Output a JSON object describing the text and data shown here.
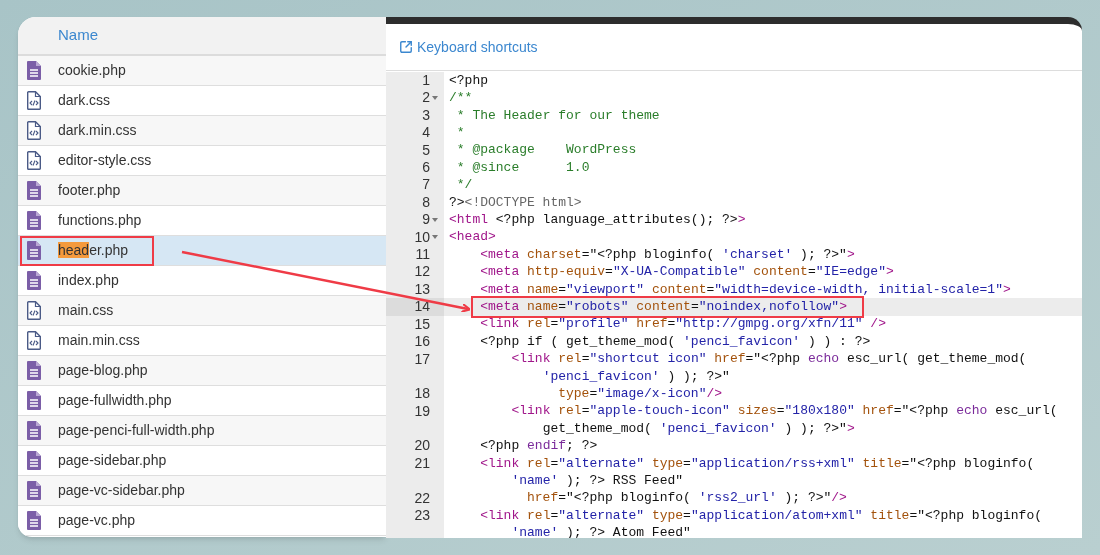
{
  "file_list": {
    "column_header": "Name",
    "files": [
      {
        "kind": "php",
        "selected": false,
        "parts": [
          {
            "text": "cookie.php",
            "highlighted": false
          }
        ]
      },
      {
        "kind": "css",
        "selected": false,
        "parts": [
          {
            "text": "dark.css",
            "highlighted": false
          }
        ]
      },
      {
        "kind": "css",
        "selected": false,
        "parts": [
          {
            "text": "dark.min.css",
            "highlighted": false
          }
        ]
      },
      {
        "kind": "css",
        "selected": false,
        "parts": [
          {
            "text": "editor-style.css",
            "highlighted": false
          }
        ]
      },
      {
        "kind": "php",
        "selected": false,
        "parts": [
          {
            "text": "footer.php",
            "highlighted": false
          }
        ]
      },
      {
        "kind": "php",
        "selected": false,
        "parts": [
          {
            "text": "functions.php",
            "highlighted": false
          }
        ]
      },
      {
        "kind": "php",
        "selected": true,
        "annotated": true,
        "parts": [
          {
            "text": "head",
            "highlighted": true
          },
          {
            "text": "er.php",
            "highlighted": false
          }
        ]
      },
      {
        "kind": "php",
        "selected": false,
        "parts": [
          {
            "text": "index.php",
            "highlighted": false
          }
        ]
      },
      {
        "kind": "css",
        "selected": false,
        "parts": [
          {
            "text": "main.css",
            "highlighted": false
          }
        ]
      },
      {
        "kind": "css",
        "selected": false,
        "parts": [
          {
            "text": "main.min.css",
            "highlighted": false
          }
        ]
      },
      {
        "kind": "php",
        "selected": false,
        "parts": [
          {
            "text": "page-blog.php",
            "highlighted": false
          }
        ]
      },
      {
        "kind": "php",
        "selected": false,
        "parts": [
          {
            "text": "page-fullwidth.php",
            "highlighted": false
          }
        ]
      },
      {
        "kind": "php",
        "selected": false,
        "parts": [
          {
            "text": "page-penci-full-width.php",
            "highlighted": false
          }
        ]
      },
      {
        "kind": "php",
        "selected": false,
        "parts": [
          {
            "text": "page-sidebar.php",
            "highlighted": false
          }
        ]
      },
      {
        "kind": "php",
        "selected": false,
        "parts": [
          {
            "text": "page-vc-sidebar.php",
            "highlighted": false
          }
        ]
      },
      {
        "kind": "php",
        "selected": false,
        "parts": [
          {
            "text": "page-vc.php",
            "highlighted": false
          }
        ]
      }
    ]
  },
  "editor": {
    "shortcuts_link": "Keyboard shortcuts",
    "lines": [
      {
        "number": "1",
        "foldable": false,
        "highlighted": false,
        "rows": [
          {
            "tokens": [
              {
                "kind": "plain",
                "text": "<?php"
              }
            ]
          }
        ]
      },
      {
        "number": "2",
        "foldable": true,
        "highlighted": false,
        "rows": [
          {
            "tokens": [
              {
                "kind": "comment",
                "text": "/**"
              }
            ]
          }
        ]
      },
      {
        "number": "3",
        "foldable": false,
        "highlighted": false,
        "rows": [
          {
            "tokens": [
              {
                "kind": "comment",
                "text": " * The Header for our theme"
              }
            ]
          }
        ]
      },
      {
        "number": "4",
        "foldable": false,
        "highlighted": false,
        "rows": [
          {
            "tokens": [
              {
                "kind": "comment",
                "text": " *"
              }
            ]
          }
        ]
      },
      {
        "number": "5",
        "foldable": false,
        "highlighted": false,
        "rows": [
          {
            "tokens": [
              {
                "kind": "comment",
                "text": " * @package    WordPress"
              }
            ]
          }
        ]
      },
      {
        "number": "6",
        "foldable": false,
        "highlighted": false,
        "rows": [
          {
            "tokens": [
              {
                "kind": "comment",
                "text": " * @since      1.0"
              }
            ]
          }
        ]
      },
      {
        "number": "7",
        "foldable": false,
        "highlighted": false,
        "rows": [
          {
            "tokens": [
              {
                "kind": "comment",
                "text": " */"
              }
            ]
          }
        ]
      },
      {
        "number": "8",
        "foldable": false,
        "highlighted": false,
        "rows": [
          {
            "tokens": [
              {
                "kind": "plain",
                "text": "?>"
              },
              {
                "kind": "doctype",
                "text": "<!DOCTYPE html>"
              }
            ]
          }
        ]
      },
      {
        "number": "9",
        "foldable": true,
        "highlighted": false,
        "rows": [
          {
            "tokens": [
              {
                "kind": "tag",
                "text": "<html"
              },
              {
                "kind": "plain",
                "text": " <?php language_attributes(); ?>"
              },
              {
                "kind": "tag",
                "text": ">"
              }
            ]
          }
        ]
      },
      {
        "number": "10",
        "foldable": true,
        "highlighted": false,
        "rows": [
          {
            "tokens": [
              {
                "kind": "tag",
                "text": "<head>"
              }
            ]
          }
        ]
      },
      {
        "number": "11",
        "foldable": false,
        "highlighted": false,
        "rows": [
          {
            "tokens": [
              {
                "kind": "tag",
                "text": "    <meta"
              },
              {
                "kind": "attr",
                "text": " charset"
              },
              {
                "kind": "plain",
                "text": "=\"<?php bloginfo( "
              },
              {
                "kind": "string",
                "text": "'charset'"
              },
              {
                "kind": "plain",
                "text": " ); ?>\""
              },
              {
                "kind": "tag",
                "text": ">"
              }
            ]
          }
        ]
      },
      {
        "number": "12",
        "foldable": false,
        "highlighted": false,
        "rows": [
          {
            "tokens": [
              {
                "kind": "tag",
                "text": "    <meta"
              },
              {
                "kind": "attr",
                "text": " http-equiv"
              },
              {
                "kind": "plain",
                "text": "="
              },
              {
                "kind": "string",
                "text": "\"X-UA-Compatible\""
              },
              {
                "kind": "attr",
                "text": " content"
              },
              {
                "kind": "plain",
                "text": "="
              },
              {
                "kind": "string",
                "text": "\"IE=edge\""
              },
              {
                "kind": "tag",
                "text": ">"
              }
            ]
          }
        ]
      },
      {
        "number": "13",
        "foldable": false,
        "highlighted": false,
        "rows": [
          {
            "tokens": [
              {
                "kind": "tag",
                "text": "    <meta"
              },
              {
                "kind": "attr",
                "text": " name"
              },
              {
                "kind": "plain",
                "text": "="
              },
              {
                "kind": "string",
                "text": "\"viewport\""
              },
              {
                "kind": "attr",
                "text": " content"
              },
              {
                "kind": "plain",
                "text": "="
              },
              {
                "kind": "string",
                "text": "\"width=device-width, initial-scale=1\""
              },
              {
                "kind": "tag",
                "text": ">"
              }
            ]
          }
        ]
      },
      {
        "number": "14",
        "foldable": false,
        "highlighted": true,
        "annotated": true,
        "rows": [
          {
            "tokens": [
              {
                "kind": "tag",
                "text": "    <meta"
              },
              {
                "kind": "attr",
                "text": " name"
              },
              {
                "kind": "plain",
                "text": "="
              },
              {
                "kind": "string",
                "text": "\"robots\""
              },
              {
                "kind": "attr",
                "text": " content"
              },
              {
                "kind": "plain",
                "text": "="
              },
              {
                "kind": "string",
                "text": "\"noindex,nofollow\""
              },
              {
                "kind": "tag",
                "text": ">"
              }
            ]
          }
        ]
      },
      {
        "number": "15",
        "foldable": false,
        "highlighted": false,
        "rows": [
          {
            "tokens": [
              {
                "kind": "tag",
                "text": "    <link"
              },
              {
                "kind": "attr",
                "text": " rel"
              },
              {
                "kind": "plain",
                "text": "="
              },
              {
                "kind": "string",
                "text": "\"profile\""
              },
              {
                "kind": "attr",
                "text": " href"
              },
              {
                "kind": "plain",
                "text": "="
              },
              {
                "kind": "string",
                "text": "\"http://gmpg.org/xfn/11\""
              },
              {
                "kind": "tag",
                "text": " />"
              }
            ]
          }
        ]
      },
      {
        "number": "16",
        "foldable": false,
        "highlighted": false,
        "rows": [
          {
            "tokens": [
              {
                "kind": "plain",
                "text": "    <?php if ( get_theme_mod( "
              },
              {
                "kind": "string",
                "text": "'penci_favicon'"
              },
              {
                "kind": "plain",
                "text": " ) ) : ?>"
              }
            ]
          }
        ]
      },
      {
        "number": "17",
        "foldable": false,
        "highlighted": false,
        "rows": [
          {
            "tokens": [
              {
                "kind": "tag",
                "text": "        <link"
              },
              {
                "kind": "attr",
                "text": " rel"
              },
              {
                "kind": "plain",
                "text": "="
              },
              {
                "kind": "string",
                "text": "\"shortcut icon\""
              },
              {
                "kind": "attr",
                "text": " href"
              },
              {
                "kind": "plain",
                "text": "=\"<?php "
              },
              {
                "kind": "keyword",
                "text": "echo"
              },
              {
                "kind": "plain",
                "text": " esc_url( get_theme_mod("
              }
            ]
          },
          {
            "tokens": [
              {
                "kind": "string",
                "text": "            'penci_favicon'"
              },
              {
                "kind": "plain",
                "text": " ) ); ?>\""
              }
            ]
          }
        ]
      },
      {
        "number": "18",
        "foldable": false,
        "highlighted": false,
        "rows": [
          {
            "tokens": [
              {
                "kind": "attr",
                "text": "              type"
              },
              {
                "kind": "plain",
                "text": "="
              },
              {
                "kind": "string",
                "text": "\"image/x-icon\""
              },
              {
                "kind": "tag",
                "text": "/>"
              }
            ]
          }
        ]
      },
      {
        "number": "19",
        "foldable": false,
        "highlighted": false,
        "rows": [
          {
            "tokens": [
              {
                "kind": "tag",
                "text": "        <link"
              },
              {
                "kind": "attr",
                "text": " rel"
              },
              {
                "kind": "plain",
                "text": "="
              },
              {
                "kind": "string",
                "text": "\"apple-touch-icon\""
              },
              {
                "kind": "attr",
                "text": " sizes"
              },
              {
                "kind": "plain",
                "text": "="
              },
              {
                "kind": "string",
                "text": "\"180x180\""
              },
              {
                "kind": "attr",
                "text": " href"
              },
              {
                "kind": "plain",
                "text": "=\"<?php "
              },
              {
                "kind": "keyword",
                "text": "echo"
              },
              {
                "kind": "plain",
                "text": " esc_url("
              }
            ]
          },
          {
            "tokens": [
              {
                "kind": "plain",
                "text": "            get_theme_mod( "
              },
              {
                "kind": "string",
                "text": "'penci_favicon'"
              },
              {
                "kind": "plain",
                "text": " ) ); ?>\""
              },
              {
                "kind": "tag",
                "text": ">"
              }
            ]
          }
        ]
      },
      {
        "number": "20",
        "foldable": false,
        "highlighted": false,
        "rows": [
          {
            "tokens": [
              {
                "kind": "plain",
                "text": "    <?php "
              },
              {
                "kind": "keyword",
                "text": "endif"
              },
              {
                "kind": "plain",
                "text": "; ?>"
              }
            ]
          }
        ]
      },
      {
        "number": "21",
        "foldable": false,
        "highlighted": false,
        "rows": [
          {
            "tokens": [
              {
                "kind": "tag",
                "text": "    <link"
              },
              {
                "kind": "attr",
                "text": " rel"
              },
              {
                "kind": "plain",
                "text": "="
              },
              {
                "kind": "string",
                "text": "\"alternate\""
              },
              {
                "kind": "attr",
                "text": " type"
              },
              {
                "kind": "plain",
                "text": "="
              },
              {
                "kind": "string",
                "text": "\"application/rss+xml\""
              },
              {
                "kind": "attr",
                "text": " title"
              },
              {
                "kind": "plain",
                "text": "=\"<?php bloginfo("
              }
            ]
          },
          {
            "tokens": [
              {
                "kind": "string",
                "text": "        'name'"
              },
              {
                "kind": "plain",
                "text": " ); ?> RSS Feed\""
              }
            ]
          }
        ]
      },
      {
        "number": "22",
        "foldable": false,
        "highlighted": false,
        "rows": [
          {
            "tokens": [
              {
                "kind": "attr",
                "text": "          href"
              },
              {
                "kind": "plain",
                "text": "=\"<?php bloginfo( "
              },
              {
                "kind": "string",
                "text": "'rss2_url'"
              },
              {
                "kind": "plain",
                "text": " ); ?>\""
              },
              {
                "kind": "tag",
                "text": "/>"
              }
            ]
          }
        ]
      },
      {
        "number": "23",
        "foldable": false,
        "highlighted": false,
        "rows": [
          {
            "tokens": [
              {
                "kind": "tag",
                "text": "    <link"
              },
              {
                "kind": "attr",
                "text": " rel"
              },
              {
                "kind": "plain",
                "text": "="
              },
              {
                "kind": "string",
                "text": "\"alternate\""
              },
              {
                "kind": "attr",
                "text": " type"
              },
              {
                "kind": "plain",
                "text": "="
              },
              {
                "kind": "string",
                "text": "\"application/atom+xml\""
              },
              {
                "kind": "attr",
                "text": " title"
              },
              {
                "kind": "plain",
                "text": "=\"<?php bloginfo("
              }
            ]
          },
          {
            "tokens": [
              {
                "kind": "string",
                "text": "        'name'"
              },
              {
                "kind": "plain",
                "text": " ); ?> Atom Feed\""
              }
            ]
          }
        ]
      }
    ]
  }
}
